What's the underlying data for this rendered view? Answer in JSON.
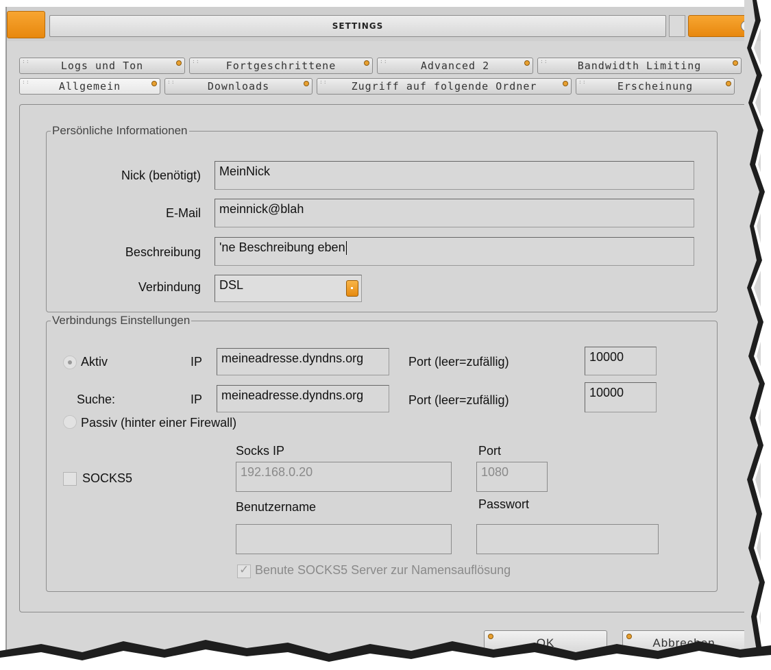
{
  "window": {
    "title": "SETTINGS"
  },
  "tabs": {
    "row1": [
      "Logs und Ton",
      "Fortgeschrittene",
      "Advanced 2",
      "Bandwidth Limiting"
    ],
    "row2": [
      "Allgemein",
      "Downloads",
      "Zugriff auf folgende Ordner",
      "Erscheinung"
    ],
    "active": "Allgemein"
  },
  "personal": {
    "legend": "Persönliche Informationen",
    "nick_label": "Nick (benötigt)",
    "nick_value": "MeinNick",
    "email_label": "E-Mail",
    "email_value": "meinnick@blah",
    "desc_label": "Beschreibung",
    "desc_value": "'ne Beschreibung eben",
    "conn_label": "Verbindung",
    "conn_value": "DSL"
  },
  "connection": {
    "legend": "Verbindungs Einstellungen",
    "active_label": "Aktiv",
    "search_label": "Suche:",
    "ip_label": "IP",
    "ip_value": "meineadresse.dyndns.org",
    "search_ip_value": "meineadresse.dyndns.org",
    "port_label": "Port (leer=zufällig)",
    "port_value": "10000",
    "search_port_value": "10000",
    "passive_label": "Passiv (hinter einer Firewall)",
    "socks5_label": "SOCKS5",
    "socks_ip_label": "Socks IP",
    "socks_ip_value": "192.168.0.20",
    "socks_port_label": "Port",
    "socks_port_value": "1080",
    "username_label": "Benutzername",
    "username_value": "",
    "password_label": "Passwort",
    "password_value": "",
    "resolve_label": "Benute SOCKS5 Server zur Namensauflösung"
  },
  "buttons": {
    "ok": "OK",
    "cancel": "Abbrechen"
  },
  "colors": {
    "accent": "#f0981e",
    "window_bg": "#d6d6d6"
  }
}
